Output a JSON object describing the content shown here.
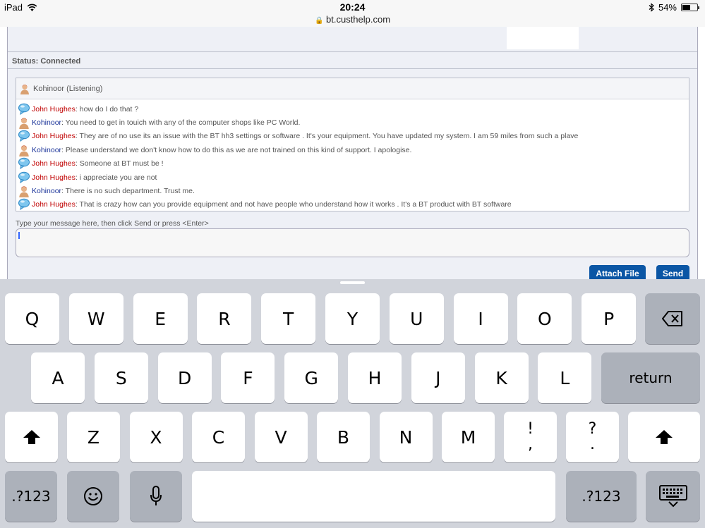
{
  "status_bar": {
    "device": "iPad",
    "time": "20:24",
    "url": "bt.custhelp.com",
    "battery": "54%",
    "battery_level": 0.54
  },
  "chat": {
    "status": "Status: Connected",
    "agent_header": "Kohinoor (Listening)",
    "messages": [
      {
        "sender": "John Hughes",
        "role": "user",
        "text": ": how do I do that ?"
      },
      {
        "sender": "Kohinoor",
        "role": "agent",
        "text": ": You need to get in touich with any of the computer shops like PC World."
      },
      {
        "sender": "John Hughes",
        "role": "user",
        "text": ": They are of no use its an issue with the BT hh3 settings or software . It's your equipment. You have updated my system. I am 59 miles from such a plave"
      },
      {
        "sender": "Kohinoor",
        "role": "agent",
        "text": ": Please understand we don't know how to do this as we are not trained on this kind of support. I apologise."
      },
      {
        "sender": "John Hughes",
        "role": "user",
        "text": ": Someone at BT must be !"
      },
      {
        "sender": "John Hughes",
        "role": "user",
        "text": ": i appreciate you are not"
      },
      {
        "sender": "Kohinoor",
        "role": "agent",
        "text": ": There is no such department. Trust me."
      },
      {
        "sender": "John Hughes",
        "role": "user",
        "text": ": That is crazy how can you provide equipment and not have people who understand how it works . It's a BT product with BT software"
      }
    ],
    "input_hint": "Type your message here, then click Send or press <Enter>",
    "input_value": "",
    "attach_label": "Attach File",
    "send_label": "Send"
  },
  "keyboard": {
    "row1": [
      "Q",
      "W",
      "E",
      "R",
      "T",
      "Y",
      "U",
      "I",
      "O",
      "P"
    ],
    "row2": [
      "A",
      "S",
      "D",
      "F",
      "G",
      "H",
      "J",
      "K",
      "L"
    ],
    "row3": [
      "Z",
      "X",
      "C",
      "V",
      "B",
      "N",
      "M"
    ],
    "punct1": [
      "!",
      ","
    ],
    "punct2": [
      "?",
      "."
    ],
    "return_label": "return",
    "numbers_label": ".?123",
    "icons": {
      "delete": "backspace-icon",
      "shift": "shift-icon",
      "emoji": "emoji-icon",
      "mic": "microphone-icon",
      "dismiss": "keyboard-dismiss-icon"
    }
  }
}
